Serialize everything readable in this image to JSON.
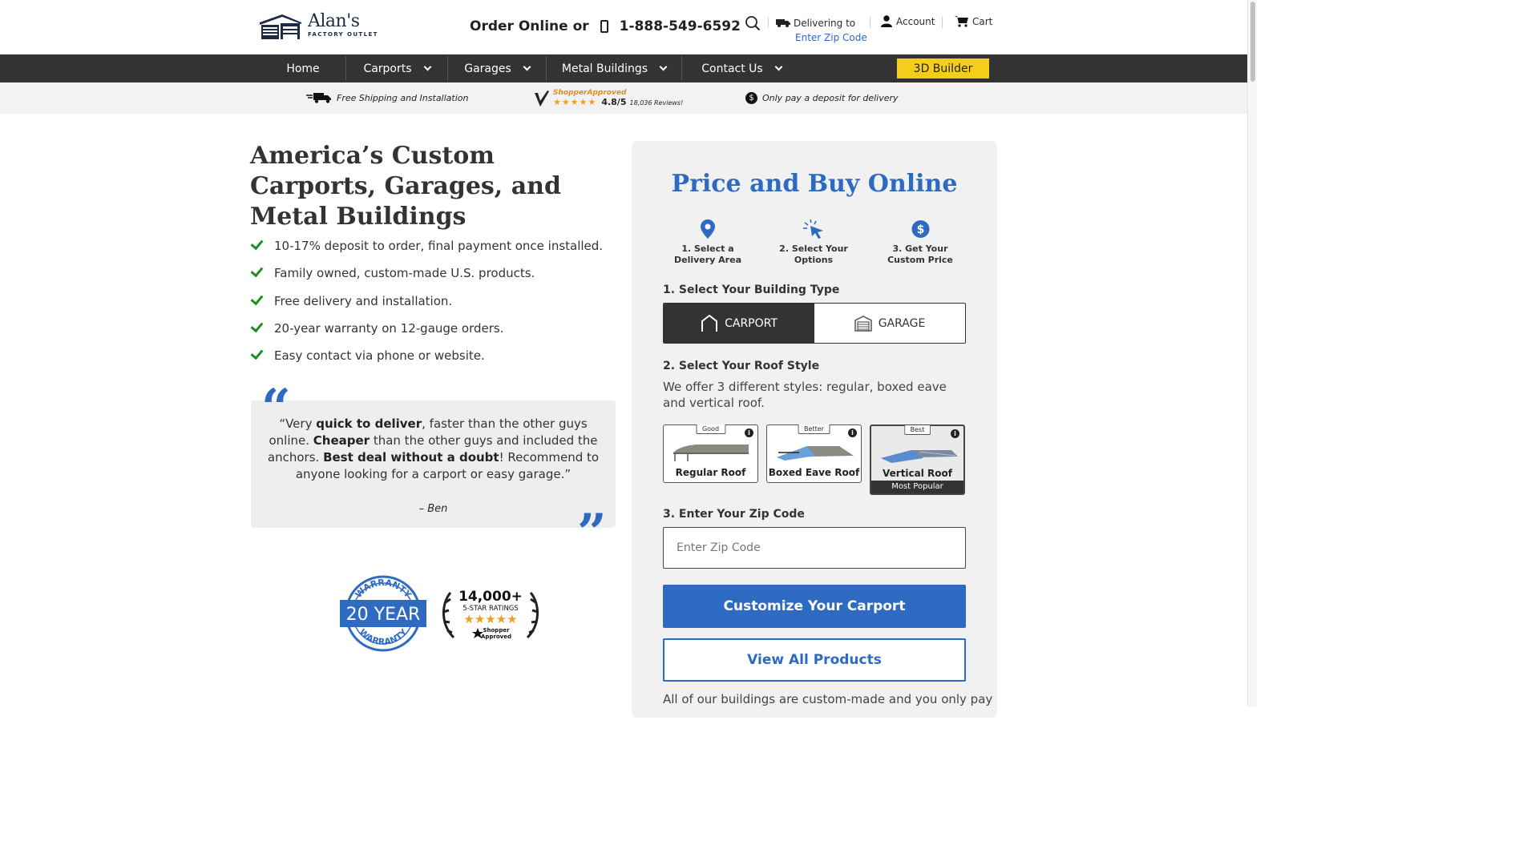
{
  "header": {
    "logo_name": "Alan's",
    "logo_sub": "FACTORY OUTLET",
    "order_label": "Order Online or",
    "phone": "1-888-549-6592",
    "delivering_label": "Delivering to",
    "zip_link": "Enter Zip Code",
    "account_label": "Account",
    "cart_label": "Cart"
  },
  "nav": {
    "items": [
      {
        "label": "Home"
      },
      {
        "label": "Carports"
      },
      {
        "label": "Garages"
      },
      {
        "label": "Metal Buildings"
      },
      {
        "label": "Contact Us"
      }
    ],
    "builder_label": "3D Builder"
  },
  "strip": {
    "shipping": "Free Shipping and Installation",
    "shopper_approved": "ShopperApproved",
    "stars": "★★★★★",
    "rating": "4.8/5",
    "reviews": "18,036 Reviews!",
    "deposit_icon": "$",
    "deposit": "Only pay a deposit for delivery"
  },
  "hero": {
    "title": "America’s Custom Carports, Garages, and Metal Buildings",
    "bullets": [
      "10-17% deposit to order, final payment once installed.",
      "Family owned, custom-made U.S. products.",
      "Free delivery and installation.",
      "20-year warranty on 12-gauge orders.",
      "Easy contact via phone or website."
    ]
  },
  "testimonial": {
    "open_mark": "“",
    "close_mark": "”",
    "p1": "“Very ",
    "b1": "quick to deliver",
    "p2": ", faster than the other guys online. ",
    "b2": "Cheaper",
    "p3": " than the other guys and included the anchors. ",
    "b3": "Best deal without a doubt",
    "p4": "! Recommend to anyone looking for a carport or easy garage.”",
    "author": "– Ben"
  },
  "badges": {
    "warranty_top": "WARRANTY",
    "warranty_main": "20 YEAR",
    "warranty_bottom": "WARRANTY",
    "ratings_count": "14,000+",
    "ratings_label": "5-STAR RATINGS",
    "ratings_stars": "★★★★★",
    "ratings_brand_1": "Shopper",
    "ratings_brand_2": "Approved"
  },
  "card": {
    "title": "Price and Buy Online",
    "steps": [
      {
        "l1": "1. Select a",
        "l2": "Delivery Area"
      },
      {
        "l1": "2. Select Your",
        "l2": "Options"
      },
      {
        "l1": "3. Get Your",
        "l2": "Custom Price"
      }
    ],
    "building_label": "1. Select Your Building Type",
    "types": [
      "CARPORT",
      "GARAGE"
    ],
    "roof_label": "2. Select Your Roof Style",
    "roof_desc": "We offer 3 different styles: regular, boxed eave and vertical roof.",
    "roofs": [
      {
        "tag": "Good",
        "name": "Regular Roof"
      },
      {
        "tag": "Better",
        "name": "Boxed Eave Roof"
      },
      {
        "tag": "Best",
        "name": "Vertical Roof",
        "badge": "Most Popular"
      }
    ],
    "info_glyph": "i",
    "zip_label": "3. Enter Your Zip Code",
    "zip_placeholder": "Enter Zip Code",
    "primary_btn": "Customize Your Carport",
    "secondary_btn": "View All Products",
    "footer_text": "All of our buildings are custom-made and you only pay"
  },
  "colors": {
    "accent_blue": "#2f6ac2",
    "nav_bg": "#333333",
    "builder_yellow": "#f6cd1a",
    "check_green": "#1c8f1c"
  }
}
